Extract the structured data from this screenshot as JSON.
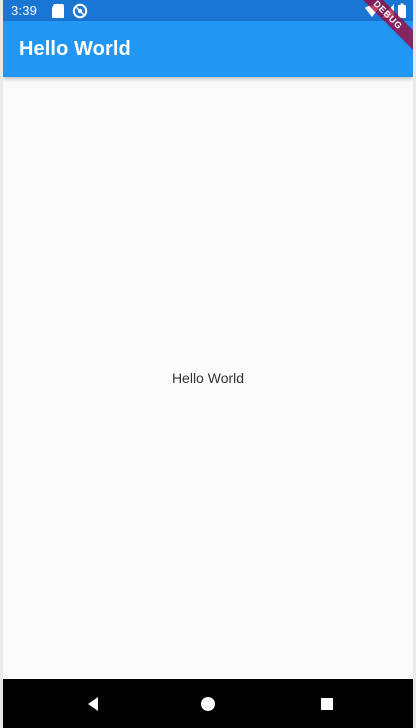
{
  "status_bar": {
    "time": "3:39",
    "icons": [
      "sd-card-icon",
      "sync-icon",
      "wifi-icon",
      "signal-icon",
      "battery-icon"
    ]
  },
  "app_bar": {
    "title": "Hello World"
  },
  "body": {
    "text": "Hello World"
  },
  "debug_banner": {
    "label": "DEBUG"
  },
  "navigation_bar": {
    "buttons": [
      "back-icon",
      "home-icon",
      "recents-icon"
    ]
  },
  "colors": {
    "status_bar": "#1976d2",
    "app_bar": "#2196f3",
    "background": "#fafafa",
    "navigation_bar": "#000000",
    "debug_banner": "#a30032"
  }
}
